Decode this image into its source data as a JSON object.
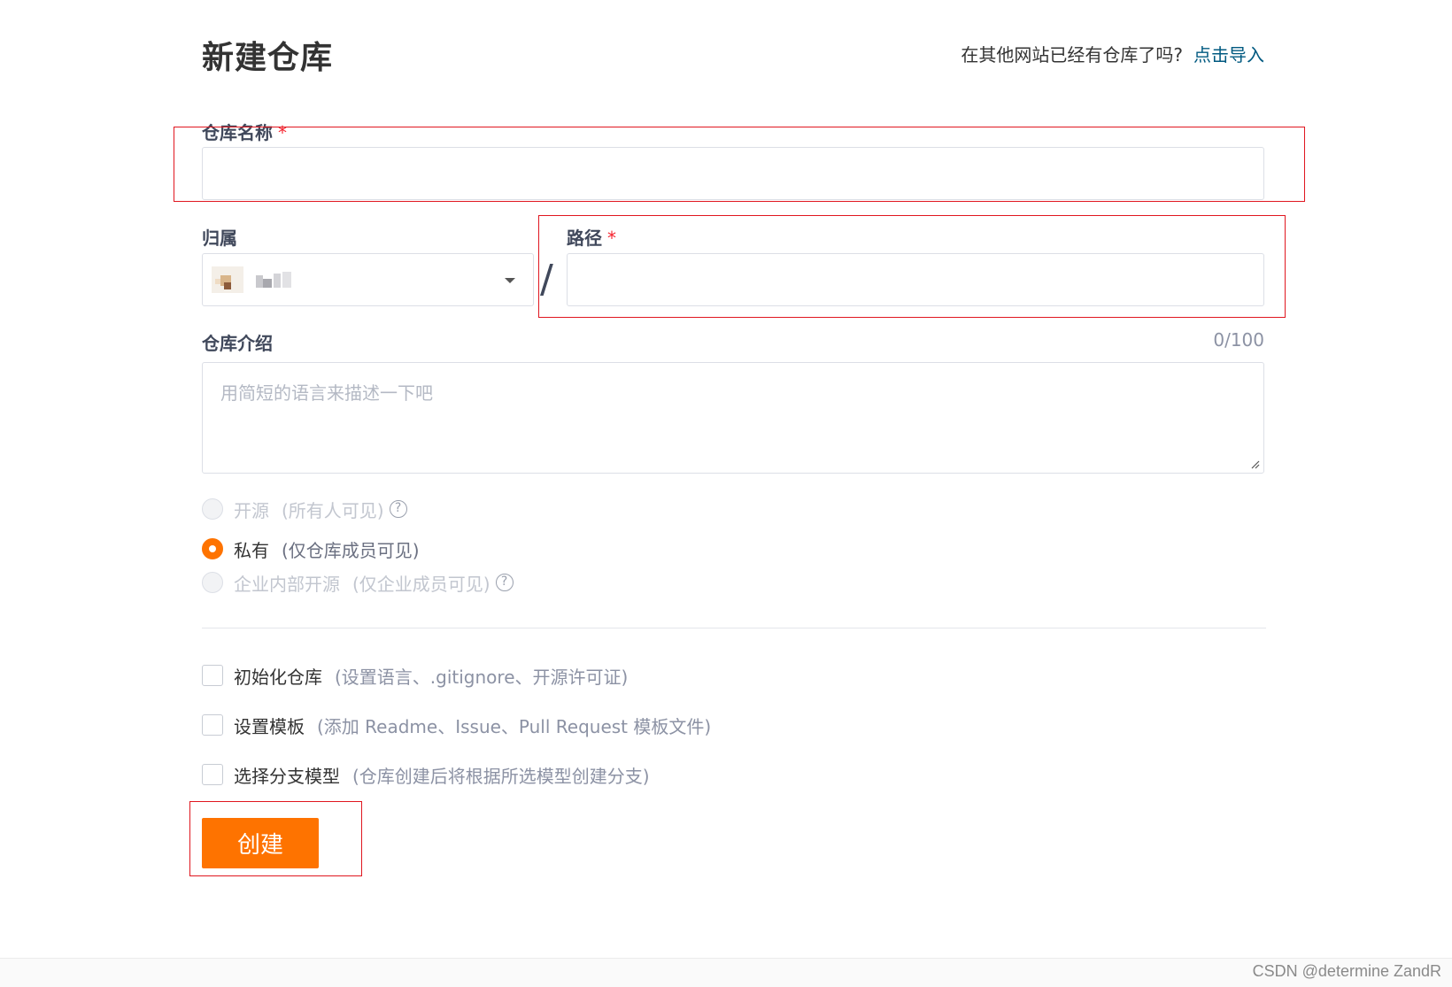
{
  "header": {
    "title": "新建仓库",
    "import_prompt": "在其他网站已经有仓库了吗?",
    "import_link": "点击导入"
  },
  "form": {
    "name": {
      "label": "仓库名称",
      "required": "*",
      "value": ""
    },
    "owner": {
      "label": "归属"
    },
    "separator": "/",
    "path": {
      "label": "路径",
      "required": "*",
      "value": ""
    },
    "description": {
      "label": "仓库介绍",
      "counter": "0/100",
      "placeholder": "用简短的语言来描述一下吧"
    },
    "visibility": [
      {
        "label": "开源",
        "hint": "(所有人可见)",
        "help": "?",
        "state": "disabled"
      },
      {
        "label": "私有",
        "hint": "(仅仓库成员可见)",
        "state": "checked"
      },
      {
        "label": "企业内部开源",
        "hint": "(仅企业成员可见)",
        "help": "?",
        "state": "disabled"
      }
    ],
    "options": [
      {
        "label": "初始化仓库",
        "hint": "(设置语言、.gitignore、开源许可证)",
        "checked": false
      },
      {
        "label": "设置模板",
        "hint": "(添加 Readme、Issue、Pull Request 模板文件)",
        "checked": false
      },
      {
        "label": "选择分支模型",
        "hint": "(仓库创建后将根据所选模型创建分支)",
        "checked": false
      }
    ],
    "submit_label": "创建"
  },
  "colors": {
    "accent": "#fe7300",
    "link": "#005980",
    "annotation": "#e0161f"
  },
  "watermark": "CSDN @determine  ZandR"
}
